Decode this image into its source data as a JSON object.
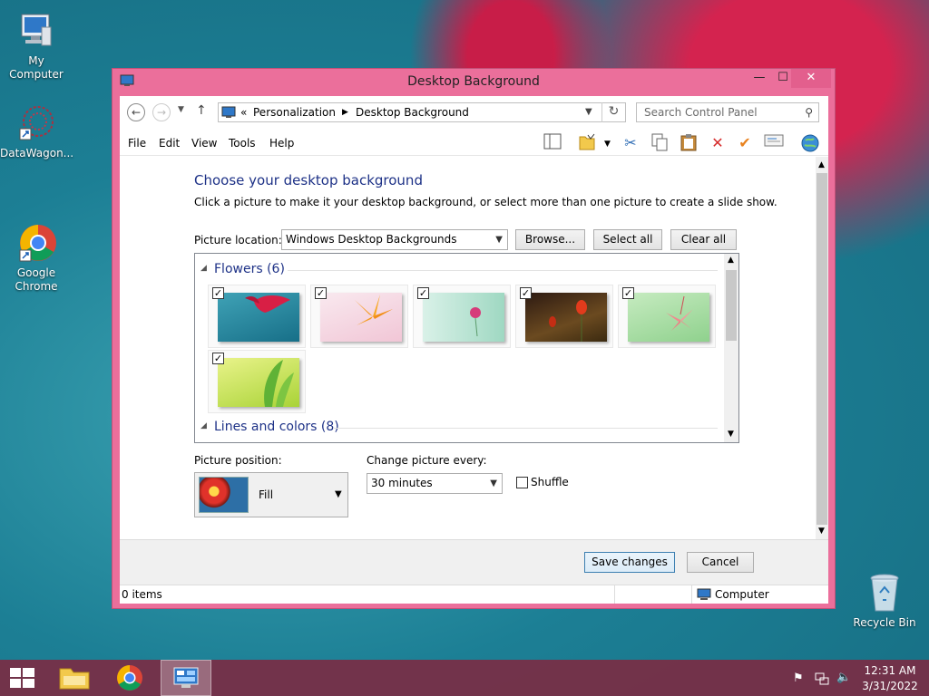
{
  "desktop": {
    "icons": [
      {
        "label": "My Computer"
      },
      {
        "label": "DataWagon..."
      },
      {
        "label": "Google\nChrome"
      },
      {
        "label": "Recycle Bin"
      }
    ]
  },
  "window": {
    "title": "Desktop Background",
    "controls": {
      "minimize": "—",
      "maximize": "☐",
      "close": "✕"
    },
    "address": {
      "prefix": "«",
      "crumbs": [
        "Personalization",
        "Desktop Background"
      ],
      "search_placeholder": "Search Control Panel"
    },
    "menu": [
      "File",
      "Edit",
      "View",
      "Tools",
      "Help"
    ],
    "content": {
      "heading": "Choose your desktop background",
      "subtext": "Click a picture to make it your desktop background, or select more than one picture to create a slide show.",
      "picture_location_label": "Picture location:",
      "picture_location_value": "Windows Desktop Backgrounds",
      "browse_label": "Browse...",
      "select_all_label": "Select all",
      "clear_all_label": "Clear all",
      "groups": [
        {
          "name": "Flowers (6)",
          "count": 6,
          "checked": [
            true,
            true,
            true,
            true,
            true,
            true
          ]
        },
        {
          "name": "Lines and colors (8)"
        }
      ],
      "picture_position_label": "Picture position:",
      "picture_position_value": "Fill",
      "change_every_label": "Change picture every:",
      "change_every_value": "30 minutes",
      "shuffle_label": "Shuffle",
      "shuffle_checked": false
    },
    "footer": {
      "save_label": "Save changes",
      "cancel_label": "Cancel"
    },
    "status": {
      "items": "0 items",
      "location": "Computer"
    }
  },
  "taskbar": {
    "time": "12:31 AM",
    "date": "3/31/2022"
  },
  "colors": {
    "window_frame": "#eb6f9b",
    "heading": "#1e3287",
    "taskbar": "#7a2c44"
  }
}
